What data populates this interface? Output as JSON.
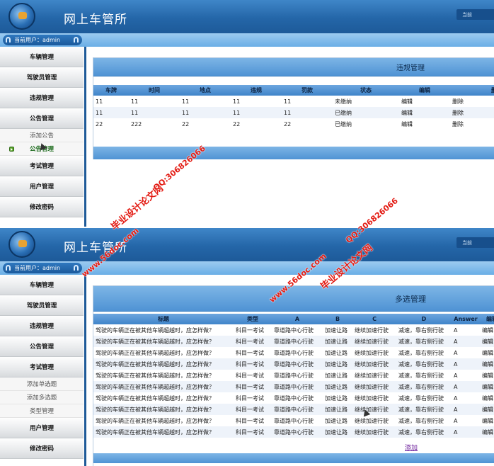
{
  "app": {
    "title": "网上车管所",
    "header_tab": "当前",
    "user_label": "当前用户：admin"
  },
  "shot1": {
    "menu": [
      "车辆管理",
      "驾驶员管理",
      "违规管理",
      "公告管理"
    ],
    "submenu": [
      "添加公告",
      "公告管理"
    ],
    "menu_after": [
      "考试管理",
      "用户管理",
      "修改密码"
    ],
    "panel_title": "违规管理",
    "columns": [
      "车牌",
      "时间",
      "地点",
      "违规",
      "罚款",
      "状态",
      "编辑",
      "删除"
    ],
    "rows": [
      [
        "11",
        "11",
        "11",
        "11",
        "11",
        "未缴纳",
        "编辑",
        "删除"
      ],
      [
        "11",
        "11",
        "11",
        "11",
        "11",
        "已缴纳",
        "编辑",
        "删除"
      ],
      [
        "22",
        "222",
        "22",
        "22",
        "22",
        "已缴纳",
        "编辑",
        "删除"
      ]
    ]
  },
  "shot2": {
    "menu": [
      "车辆管理",
      "驾驶员管理",
      "违规管理",
      "公告管理",
      "考试管理"
    ],
    "submenu": [
      "添加单选题",
      "添加多选题",
      "类型管理"
    ],
    "menu_after": [
      "用户管理",
      "修改密码"
    ],
    "panel_title": "多选管理",
    "columns": [
      "标题",
      "类型",
      "A",
      "B",
      "C",
      "D",
      "Answer",
      "编辑"
    ],
    "row": [
      "驾驶的车辆正在被其他车辆超越时，应怎样做？",
      "科目一考试",
      "靠道路中心行驶",
      "加速让路",
      "继续加速行驶",
      "减速，靠右侧行驶",
      "A",
      "编辑"
    ],
    "row_count": 10,
    "add_link": "添加"
  },
  "watermarks": {
    "site_name": "毕业设计论文网",
    "url": "www.56doc.com",
    "qq": "QQ:306826066"
  }
}
